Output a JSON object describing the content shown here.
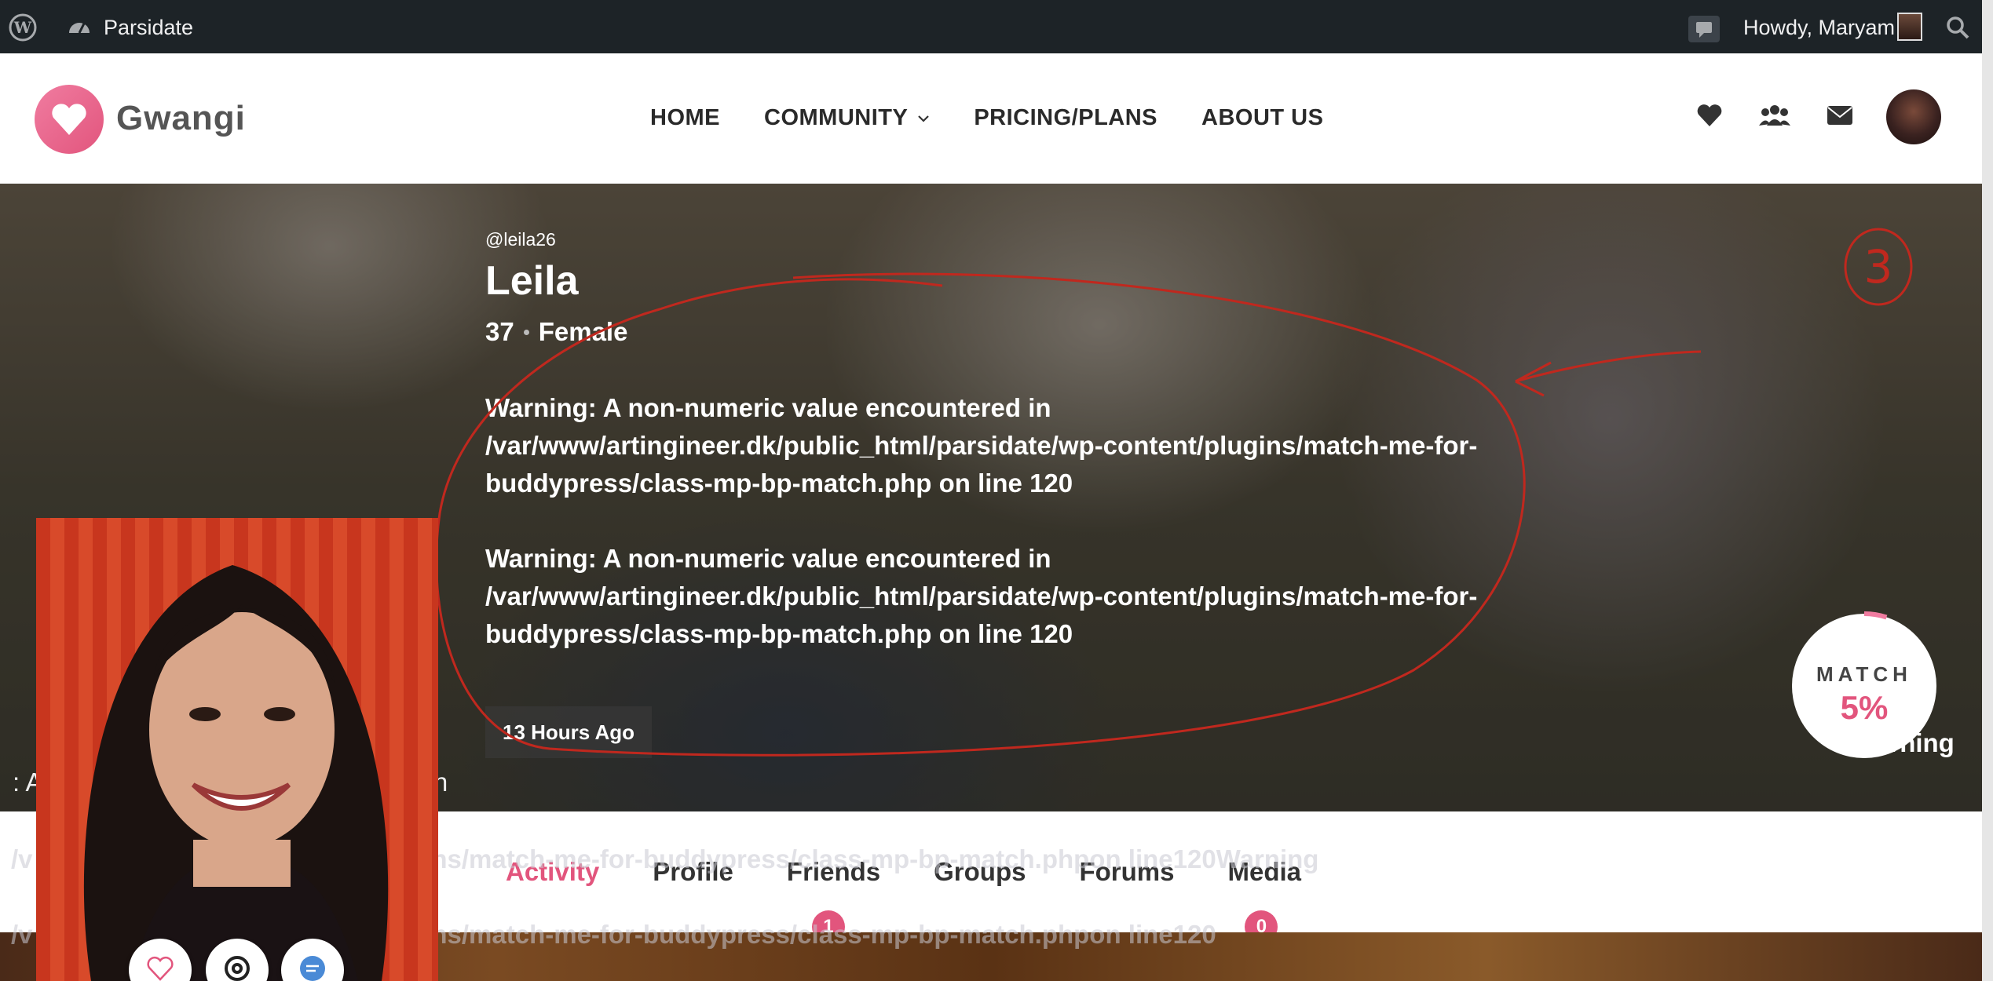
{
  "admin_bar": {
    "site_name": "Parsidate",
    "greeting": "Howdy, Maryam"
  },
  "header": {
    "logo_text": "Gwangi",
    "nav": [
      {
        "label": "HOME"
      },
      {
        "label": "COMMUNITY"
      },
      {
        "label": "PRICING/PLANS"
      },
      {
        "label": "ABOUT US"
      }
    ]
  },
  "profile": {
    "username": "@leila26",
    "display_name": "Leila",
    "age": "37",
    "gender": "Female",
    "warnings": [
      "Warning: A non-numeric value encountered in /var/www/artingineer.dk/public_html/parsidate/wp-content/plugins/match-me-for-buddypress/class-mp-bp-match.php on line 120",
      "Warning: A non-numeric value encountered in /var/www/artingineer.dk/public_html/parsidate/wp-content/plugins/match-me-for-buddypress/class-mp-bp-match.php on line 120"
    ],
    "last_active": "13 Hours Ago",
    "fragment_left": ": A",
    "fragment_left_end": "in",
    "fragment_right": "arning",
    "match_label": "MATCH",
    "match_value": "5%",
    "match_fraction": 0.05
  },
  "tabs": [
    {
      "label": "Activity",
      "active": true
    },
    {
      "label": "Profile"
    },
    {
      "label": "Friends",
      "badge": "1"
    },
    {
      "label": "Groups"
    },
    {
      "label": "Forums"
    },
    {
      "label": "Media",
      "badge": "0"
    }
  ],
  "overlay": {
    "line1": "/v                                   html/parsidate/wp-content/plugins/match-me-for-buddypress/class-mp-bp-match.phpon line120Warning",
    "line2": "/v                                   html/parsidate/wp-content/plugins/match-me-for-buddypress/class-mp-bp-match.phpon line120"
  },
  "annotation": {
    "number": "3",
    "color": "#c0281e"
  },
  "colors": {
    "accent": "#e2557d",
    "admin_bar": "#1d2327"
  }
}
